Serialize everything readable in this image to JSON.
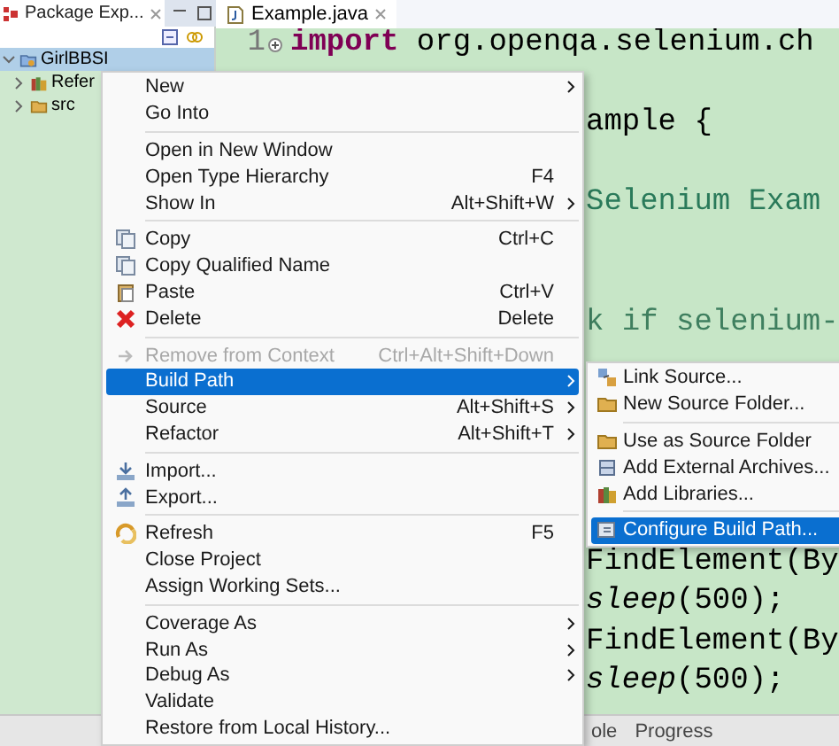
{
  "package_explorer": {
    "title": "Package Exp...",
    "tree": [
      {
        "label": "GirlBBSI",
        "kind": "project",
        "expanded": true,
        "selected": true,
        "children": [
          {
            "label": "Refer",
            "kind": "library",
            "expanded": false,
            "selected": false
          },
          {
            "label": "src",
            "kind": "package",
            "expanded": false,
            "selected": false
          }
        ]
      }
    ]
  },
  "editor": {
    "tab": "Example.java",
    "lines": [
      {
        "number": "1",
        "kind": "code",
        "text": "**import** org.openqa.selenium.ch"
      },
      {
        "kind": "code",
        "text": "ample {"
      },
      {
        "kind": "string",
        "text": "Selenium Exam"
      },
      {
        "kind": "comment",
        "text": "k if selenium-"
      },
      {
        "kind": "code",
        "text": "FindElement(By"
      },
      {
        "kind": "code",
        "text": "*sleep*(500);"
      },
      {
        "kind": "code",
        "text": "FindElement(By"
      },
      {
        "kind": "code",
        "text": "*sleep*(500);"
      }
    ]
  },
  "context_menu": {
    "items": [
      {
        "kind": "item",
        "label": "New",
        "submenu": true,
        "selected": false,
        "disabled": false
      },
      {
        "kind": "item",
        "label": "Go Into",
        "selected": false,
        "disabled": false
      },
      {
        "kind": "separator"
      },
      {
        "kind": "item",
        "label": "Open in New Window",
        "selected": false,
        "disabled": false
      },
      {
        "kind": "item",
        "label": "Open Type Hierarchy",
        "shortcut": "F4",
        "selected": false,
        "disabled": false
      },
      {
        "kind": "item",
        "label": "Show In",
        "shortcut": "Alt+Shift+W",
        "submenu": true,
        "selected": false,
        "disabled": false
      },
      {
        "kind": "separator"
      },
      {
        "kind": "copy",
        "label": "Copy",
        "shortcut": "Ctrl+C",
        "selected": false,
        "disabled": false
      },
      {
        "kind": "copy",
        "label": "Copy Qualified Name",
        "selected": false,
        "disabled": false
      },
      {
        "kind": "paste",
        "label": "Paste",
        "shortcut": "Ctrl+V",
        "selected": false,
        "disabled": false
      },
      {
        "kind": "delete",
        "label": "Delete",
        "shortcut": "Delete",
        "selected": false,
        "disabled": false
      },
      {
        "kind": "separator"
      },
      {
        "kind": "remove",
        "label": "Remove from Context",
        "shortcut": "Ctrl+Alt+Shift+Down",
        "selected": false,
        "disabled": true
      },
      {
        "kind": "item",
        "label": "Build Path",
        "submenu": true,
        "selected": true,
        "disabled": false
      },
      {
        "kind": "item",
        "label": "Source",
        "shortcut": "Alt+Shift+S",
        "submenu": true,
        "selected": false,
        "disabled": false
      },
      {
        "kind": "item",
        "label": "Refactor",
        "shortcut": "Alt+Shift+T",
        "submenu": true,
        "selected": false,
        "disabled": false
      },
      {
        "kind": "separator"
      },
      {
        "kind": "import",
        "label": "Import...",
        "selected": false,
        "disabled": false
      },
      {
        "kind": "export",
        "label": "Export...",
        "selected": false,
        "disabled": false
      },
      {
        "kind": "separator"
      },
      {
        "kind": "refresh",
        "label": "Refresh",
        "shortcut": "F5",
        "selected": false,
        "disabled": false
      },
      {
        "kind": "item",
        "label": "Close Project",
        "selected": false,
        "disabled": false
      },
      {
        "kind": "item",
        "label": "Assign Working Sets...",
        "selected": false,
        "disabled": false
      },
      {
        "kind": "separator"
      },
      {
        "kind": "item",
        "label": "Coverage As",
        "submenu": true,
        "selected": false,
        "disabled": false
      },
      {
        "kind": "item",
        "label": "Run As",
        "submenu": true,
        "selected": false,
        "disabled": false
      },
      {
        "kind": "item",
        "label": "Debug As",
        "submenu": true,
        "selected": false,
        "disabled": false
      },
      {
        "kind": "item",
        "label": "Validate",
        "selected": false,
        "disabled": false
      },
      {
        "kind": "item",
        "label": "Restore from Local History...",
        "selected": false,
        "disabled": false
      }
    ]
  },
  "build_path_submenu": {
    "items": [
      {
        "kind": "link",
        "label": "Link Source...",
        "selected": false
      },
      {
        "kind": "package",
        "label": "New Source Folder...",
        "selected": false
      },
      {
        "kind": "separator"
      },
      {
        "kind": "package",
        "label": "Use as Source Folder",
        "selected": false
      },
      {
        "kind": "archive",
        "label": "Add External Archives...",
        "selected": false
      },
      {
        "kind": "library",
        "label": "Add Libraries...",
        "selected": false
      },
      {
        "kind": "separator"
      },
      {
        "kind": "configure",
        "label": "Configure Build Path...",
        "selected": true
      }
    ]
  },
  "bottom_tabs": [
    {
      "label": "ole"
    },
    {
      "label": "Progress"
    }
  ]
}
